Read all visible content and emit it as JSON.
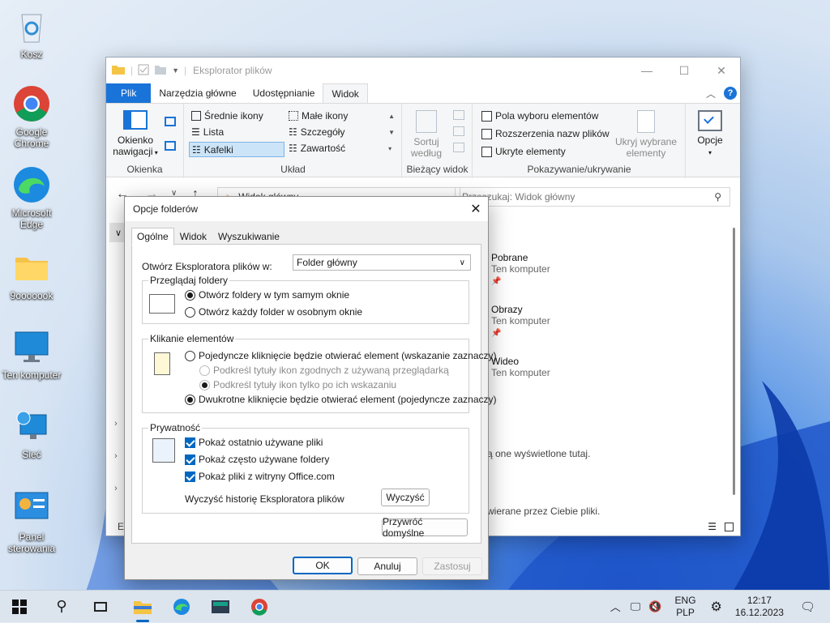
{
  "desktop": {
    "icons": [
      {
        "label": "Kosz",
        "icon": "recycle-bin-icon"
      },
      {
        "label": "Google Chrome",
        "icon": "chrome-icon"
      },
      {
        "label": "Microsoft Edge",
        "icon": "edge-icon"
      },
      {
        "label": "9ooooook",
        "icon": "folder-icon"
      },
      {
        "label": "Ten komputer",
        "icon": "computer-icon"
      },
      {
        "label": "Sieć",
        "icon": "network-icon"
      },
      {
        "label": "Panel sterowania",
        "icon": "control-panel-icon"
      }
    ]
  },
  "explorer": {
    "title": "Eksplorator plików",
    "tabs": [
      "Plik",
      "Narzędzia główne",
      "Udostępnianie",
      "Widok"
    ],
    "ribbon": {
      "panes": {
        "nav_label": "Okienko nawigacji",
        "group": "Okienka"
      },
      "layout": {
        "items": [
          "Średnie ikony",
          "Małe ikony",
          "Lista",
          "Szczegóły",
          "Kafelki",
          "Zawartość"
        ],
        "group": "Układ"
      },
      "current": {
        "sort_label": "Sortuj według",
        "group": "Bieżący widok"
      },
      "show": {
        "checkboxes": [
          "Pola wyboru elementów",
          "Rozszerzenia nazw plików",
          "Ukryte elementy"
        ],
        "hide_label": "Ukryj wybrane elementy",
        "group": "Pokazywanie/ukrywanie"
      },
      "options_label": "Opcje"
    },
    "address": "Widok główny",
    "search_placeholder": "Przeszukaj: Widok główny",
    "items": [
      {
        "title": "Pobrane",
        "sub": "Ten komputer"
      },
      {
        "title": "Obrazy",
        "sub": "Ten komputer"
      },
      {
        "title": "Wideo",
        "sub": "Ten komputer"
      }
    ],
    "msg1": "ą one wyświetlone tutaj.",
    "msg2": "wierane przez Ciebie pliki.",
    "status_left": "El"
  },
  "dialog": {
    "title": "Opcje folderów",
    "tabs": [
      "Ogólne",
      "Widok",
      "Wyszukiwanie"
    ],
    "open_label": "Otwórz Eksploratora plików w:",
    "open_value": "Folder główny",
    "browse": {
      "legend": "Przeglądaj foldery",
      "opt1": "Otwórz foldery w tym samym oknie",
      "opt2": "Otwórz każdy folder w osobnym oknie"
    },
    "click": {
      "legend": "Klikanie elementów",
      "opt1": "Pojedyncze kliknięcie będzie otwierać element (wskazanie zaznaczy)",
      "sub1": "Podkreśl tytuły ikon zgodnych z używaną przeglądarką",
      "sub2": "Podkreśl tytuły ikon tylko po ich wskazaniu",
      "opt2": "Dwukrotne kliknięcie będzie otwierać element (pojedyncze zaznaczy)"
    },
    "privacy": {
      "legend": "Prywatność",
      "c1": "Pokaż ostatnio używane pliki",
      "c2": "Pokaż często używane foldery",
      "c3": "Pokaż pliki z witryny Office.com",
      "clear_label": "Wyczyść historię Eksploratora plików",
      "clear_btn": "Wyczyść"
    },
    "restore_btn": "Przywróć domyślne",
    "ok": "OK",
    "cancel": "Anuluj",
    "apply": "Zastosuj"
  },
  "taskbar": {
    "lang1": "ENG",
    "lang2": "PLP",
    "time": "12:17",
    "date": "16.12.2023"
  }
}
